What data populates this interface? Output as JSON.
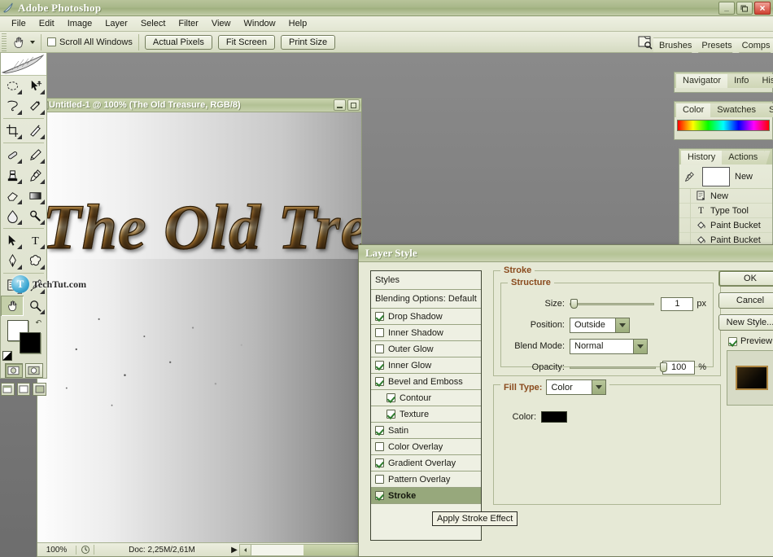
{
  "app": {
    "title": "Adobe Photoshop",
    "logo_icon": "photoshop-feather-icon"
  },
  "window_controls": {
    "minimize": "_",
    "restore": "❐",
    "close": "×"
  },
  "menubar": {
    "items": [
      "File",
      "Edit",
      "Image",
      "Layer",
      "Select",
      "Filter",
      "View",
      "Window",
      "Help"
    ]
  },
  "options_bar": {
    "tool_icon": "hand-tool-icon",
    "tool_preset_caret": "chevron-down-icon",
    "scroll_all_windows": {
      "label": "Scroll All Windows",
      "checked": false
    },
    "buttons": [
      "Actual Pixels",
      "Fit Screen",
      "Print Size"
    ],
    "palette_well_icon": "file-browser-icon",
    "palette_well_tabs": [
      "Brushes",
      "Presets",
      "Comps"
    ]
  },
  "toolbox": {
    "tools": [
      "rectangular-marquee-icon",
      "move-tool-icon",
      "lasso-tool-icon",
      "magic-wand-icon",
      "crop-tool-icon",
      "slice-tool-icon",
      "healing-brush-icon",
      "brush-tool-icon",
      "clone-stamp-icon",
      "history-brush-icon",
      "eraser-tool-icon",
      "gradient-tool-icon",
      "blur-tool-icon",
      "dodge-tool-icon",
      "path-selection-icon",
      "type-tool-icon",
      "pen-tool-icon",
      "custom-shape-icon",
      "notes-tool-icon",
      "eyedropper-icon",
      "hand-tool-icon",
      "zoom-tool-icon"
    ],
    "selected_tool": "hand-tool-icon",
    "foreground_color": "#ffffff",
    "background_color": "#000000",
    "quickmask": [
      "standard-mode-icon",
      "quick-mask-mode-icon"
    ],
    "screenmodes": [
      "standard-screen-mode-icon",
      "full-screen-menubar-icon",
      "full-screen-icon"
    ]
  },
  "watermark": {
    "badge": "T",
    "text": "TechTut.com"
  },
  "document": {
    "title": "Untitled-1 @ 100% (The Old Treasure, RGB/8)",
    "icon": "document-icon",
    "minimize_icon": "minimize-icon",
    "maximize_icon": "maximize-icon",
    "artwork_text": "The Old Treasure",
    "status": {
      "zoom": "100%",
      "preview_icon": "clock-icon",
      "doc_info": "Doc: 2,25M/2,61M",
      "menu_arrow": "▶",
      "scroll_icon": "scroll-left-icon"
    }
  },
  "palettes": {
    "navigator": {
      "tabs": [
        "Navigator",
        "Info",
        "Histogram"
      ],
      "active": "Navigator"
    },
    "color": {
      "tabs": [
        "Color",
        "Swatches",
        "Styles"
      ],
      "active": "Color",
      "ramp_name": "color-spectrum-ramp"
    },
    "history": {
      "tabs": [
        "History",
        "Actions"
      ],
      "active": "History",
      "snapshot": {
        "icon": "snapshot-brush-icon",
        "label": "New"
      },
      "states": [
        {
          "label": "New",
          "icon": "new-document-icon"
        },
        {
          "label": "Type Tool",
          "icon": "type-tool-icon"
        },
        {
          "label": "Paint Bucket",
          "icon": "paint-bucket-icon"
        },
        {
          "label": "Paint Bucket",
          "icon": "paint-bucket-icon"
        }
      ]
    }
  },
  "dialog": {
    "title": "Layer Style",
    "styles_header": "Styles",
    "blending_options": "Blending Options: Default",
    "effects": [
      {
        "label": "Drop Shadow",
        "checked": true,
        "indent": false,
        "selected": false
      },
      {
        "label": "Inner Shadow",
        "checked": false,
        "indent": false,
        "selected": false
      },
      {
        "label": "Outer Glow",
        "checked": false,
        "indent": false,
        "selected": false
      },
      {
        "label": "Inner Glow",
        "checked": true,
        "indent": false,
        "selected": false
      },
      {
        "label": "Bevel and Emboss",
        "checked": true,
        "indent": false,
        "selected": false
      },
      {
        "label": "Contour",
        "checked": true,
        "indent": true,
        "selected": false
      },
      {
        "label": "Texture",
        "checked": true,
        "indent": true,
        "selected": false
      },
      {
        "label": "Satin",
        "checked": true,
        "indent": false,
        "selected": false
      },
      {
        "label": "Color Overlay",
        "checked": false,
        "indent": false,
        "selected": false
      },
      {
        "label": "Gradient Overlay",
        "checked": true,
        "indent": false,
        "selected": false
      },
      {
        "label": "Pattern Overlay",
        "checked": false,
        "indent": false,
        "selected": false
      },
      {
        "label": "Stroke",
        "checked": true,
        "indent": false,
        "selected": true
      }
    ],
    "panel": {
      "legend": "Stroke",
      "structure": {
        "legend": "Structure",
        "size_label": "Size:",
        "size_value": "1",
        "size_unit": "px",
        "size_percent": 3,
        "position_label": "Position:",
        "position_value": "Outside",
        "blend_mode_label": "Blend Mode:",
        "blend_mode_value": "Normal",
        "opacity_label": "Opacity:",
        "opacity_value": "100",
        "opacity_unit": "%",
        "opacity_percent": 100
      },
      "fill": {
        "fill_type_label": "Fill Type:",
        "fill_type_value": "Color",
        "color_label": "Color:",
        "color_value": "#000000"
      }
    },
    "buttons": {
      "ok": "OK",
      "cancel": "Cancel",
      "new_style": "New Style...",
      "preview_label": "Preview",
      "preview_checked": true
    }
  },
  "tooltip": {
    "text": "Apply Stroke Effect"
  },
  "colors": {
    "chrome_green": "#b5c396",
    "panel_bg": "#e6e9d6",
    "legend_orange": "#8a4b1e",
    "selection_green": "#97a87c"
  }
}
